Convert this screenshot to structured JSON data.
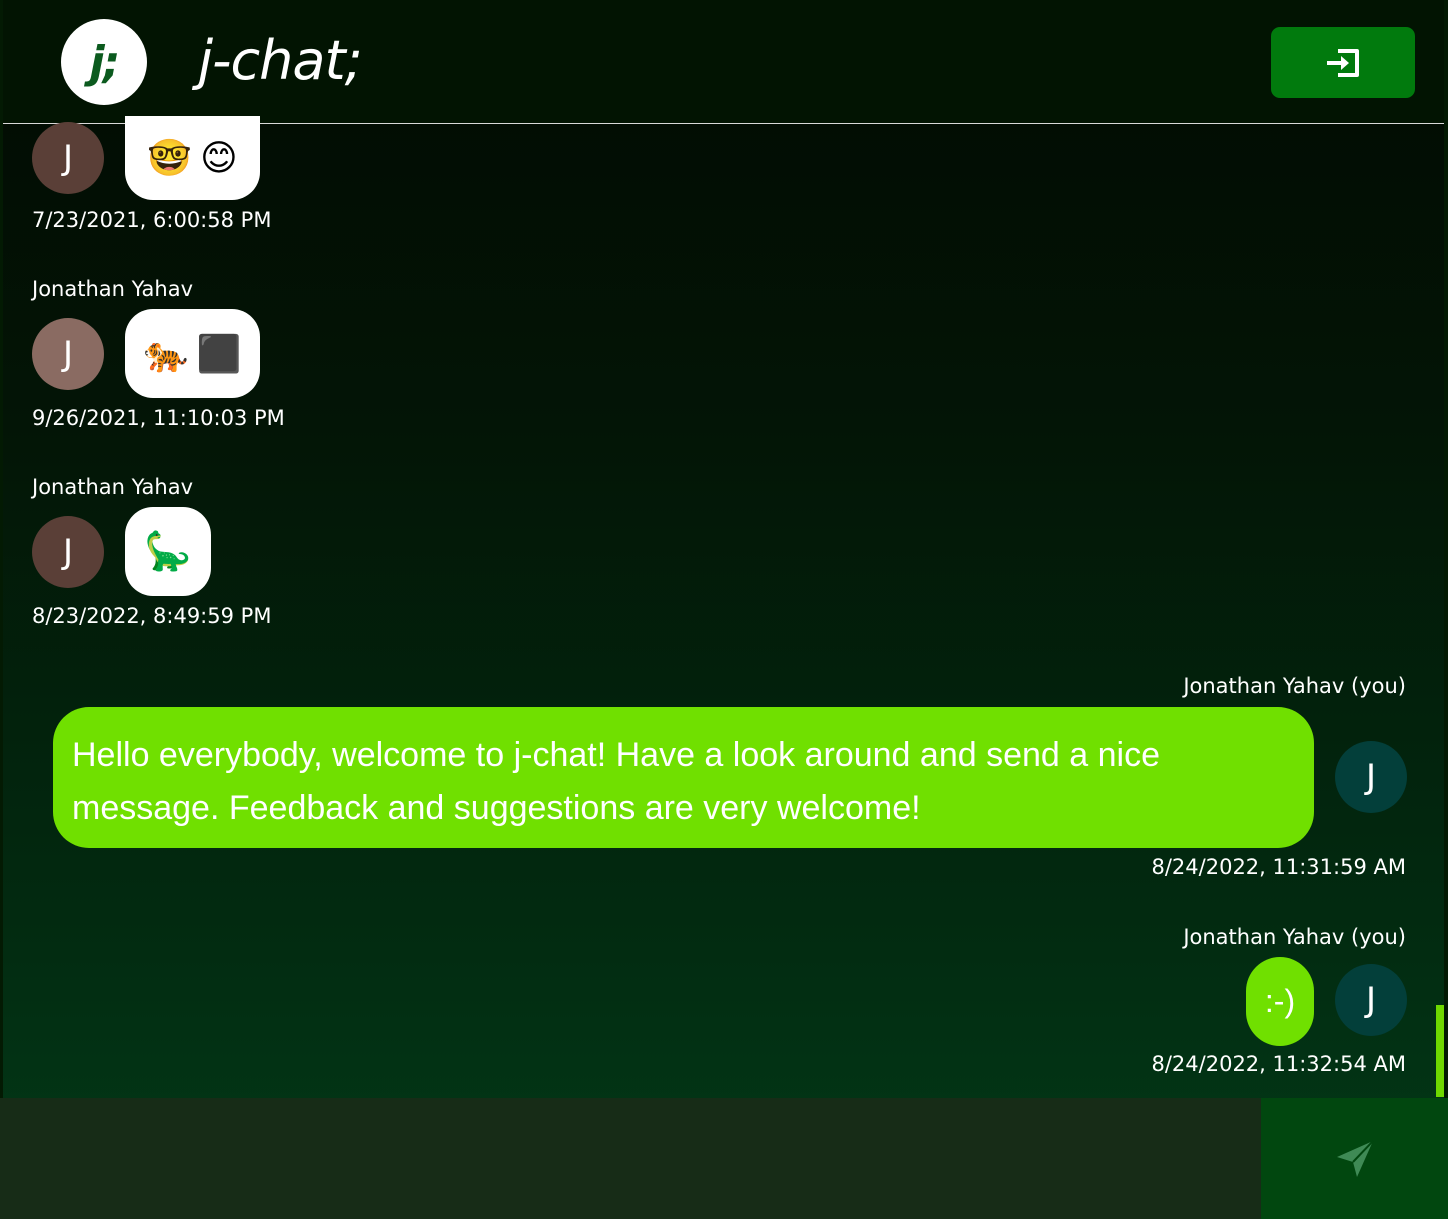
{
  "app": {
    "logo_text": "j;",
    "title": "j-chat;",
    "logout_icon": "logout-icon"
  },
  "messages": [
    {
      "sender": "",
      "avatar_letter": "J",
      "avatar_color": "#5a3f37",
      "content": [
        "nerd-face-emoji",
        "smiling-face-emoji"
      ],
      "content_glyphs": [
        "🤓",
        "😊"
      ],
      "timestamp": "7/23/2021, 6:00:58 PM",
      "own": false
    },
    {
      "sender": "Jonathan Yahav",
      "avatar_letter": "J",
      "avatar_color": "#8a6b62",
      "content": [
        "tiger-emoji",
        "black-square-emoji"
      ],
      "content_glyphs": [
        "🐅",
        "⬛"
      ],
      "timestamp": "9/26/2021, 11:10:03 PM",
      "own": false
    },
    {
      "sender": "Jonathan Yahav",
      "avatar_letter": "J",
      "avatar_color": "#5a3f37",
      "content": [
        "sauropod-emoji"
      ],
      "content_glyphs": [
        "🦕"
      ],
      "timestamp": "8/23/2022, 8:49:59 PM",
      "own": false
    },
    {
      "sender": "Jonathan Yahav (you)",
      "avatar_letter": "J",
      "avatar_color": "#033f3a",
      "text": "Hello everybody, welcome to j-chat! Have a look around and send a nice message. Feedback and suggestions are very welcome!",
      "timestamp": "8/24/2022, 11:31:59 AM",
      "own": true
    },
    {
      "sender": "Jonathan Yahav (you)",
      "avatar_letter": "J",
      "avatar_color": "#033f3a",
      "text": ":-)",
      "timestamp": "8/24/2022, 11:32:54 AM",
      "own": true
    }
  ],
  "composer": {
    "placeholder": "",
    "value": "",
    "send_icon": "send-icon"
  },
  "colors": {
    "accent_green": "#70e000",
    "header_bg": "#021402",
    "button_green": "#017a0d",
    "send_bg": "#01470f",
    "input_bg": "#172c17"
  }
}
